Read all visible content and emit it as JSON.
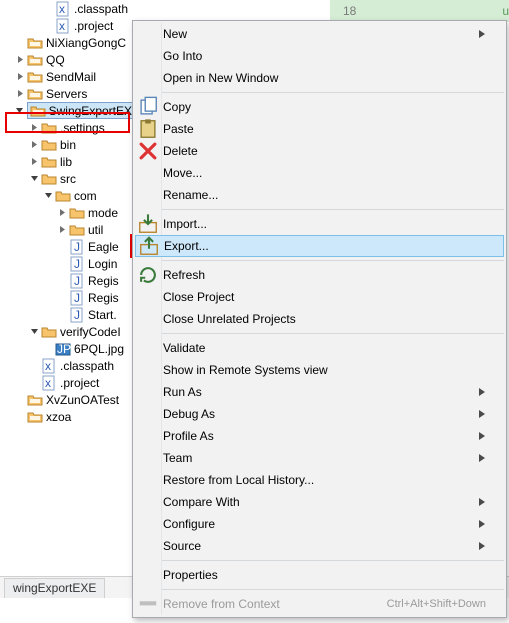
{
  "gutter": {
    "line_no": "18",
    "char": "u"
  },
  "tree": [
    {
      "indent": 3,
      "twist": "none",
      "icon": "xfile",
      "label": ".classpath"
    },
    {
      "indent": 3,
      "twist": "none",
      "icon": "xfile",
      "label": ".project"
    },
    {
      "indent": 1,
      "twist": "none",
      "icon": "project",
      "label": "NiXiangGongC"
    },
    {
      "indent": 1,
      "twist": "closed",
      "icon": "project",
      "label": "QQ"
    },
    {
      "indent": 1,
      "twist": "closed",
      "icon": "project",
      "label": "SendMail"
    },
    {
      "indent": 1,
      "twist": "closed",
      "icon": "project",
      "label": "Servers"
    },
    {
      "indent": 1,
      "twist": "open",
      "icon": "project",
      "label": "SwingExportEX",
      "selected": true
    },
    {
      "indent": 2,
      "twist": "closed",
      "icon": "folder",
      "label": ".settings"
    },
    {
      "indent": 2,
      "twist": "closed",
      "icon": "folder",
      "label": "bin"
    },
    {
      "indent": 2,
      "twist": "closed",
      "icon": "folder",
      "label": "lib"
    },
    {
      "indent": 2,
      "twist": "open",
      "icon": "folder",
      "label": "src"
    },
    {
      "indent": 3,
      "twist": "open",
      "icon": "folder",
      "label": "com"
    },
    {
      "indent": 4,
      "twist": "closed",
      "icon": "folder",
      "label": "mode"
    },
    {
      "indent": 4,
      "twist": "closed",
      "icon": "folder",
      "label": "util"
    },
    {
      "indent": 4,
      "twist": "none",
      "icon": "java",
      "label": "Eagle"
    },
    {
      "indent": 4,
      "twist": "none",
      "icon": "java",
      "label": "Login"
    },
    {
      "indent": 4,
      "twist": "none",
      "icon": "java",
      "label": "Regis"
    },
    {
      "indent": 4,
      "twist": "none",
      "icon": "java",
      "label": "Regis"
    },
    {
      "indent": 4,
      "twist": "none",
      "icon": "java",
      "label": "Start."
    },
    {
      "indent": 2,
      "twist": "open",
      "icon": "folder",
      "label": "verifyCodeI"
    },
    {
      "indent": 3,
      "twist": "none",
      "icon": "jpg",
      "label": "6PQL.jpg"
    },
    {
      "indent": 2,
      "twist": "none",
      "icon": "xfile",
      "label": ".classpath"
    },
    {
      "indent": 2,
      "twist": "none",
      "icon": "xfile",
      "label": ".project"
    },
    {
      "indent": 1,
      "twist": "none",
      "icon": "project",
      "label": "XvZunOATest"
    },
    {
      "indent": 1,
      "twist": "none",
      "icon": "project",
      "label": "xzoa"
    }
  ],
  "bottombar": {
    "tab": "wingExportEXE"
  },
  "menu": [
    {
      "type": "item",
      "icon": "",
      "label": "New",
      "sub": true
    },
    {
      "type": "item",
      "icon": "",
      "label": "Go Into"
    },
    {
      "type": "item",
      "icon": "",
      "label": "Open in New Window"
    },
    {
      "type": "sep"
    },
    {
      "type": "item",
      "icon": "copy",
      "label": "Copy"
    },
    {
      "type": "item",
      "icon": "paste",
      "label": "Paste"
    },
    {
      "type": "item",
      "icon": "delete",
      "label": "Delete"
    },
    {
      "type": "item",
      "icon": "",
      "label": "Move..."
    },
    {
      "type": "item",
      "icon": "",
      "label": "Rename..."
    },
    {
      "type": "sep"
    },
    {
      "type": "item",
      "icon": "import",
      "label": "Import..."
    },
    {
      "type": "item",
      "icon": "export",
      "label": "Export...",
      "selected": true
    },
    {
      "type": "sep"
    },
    {
      "type": "item",
      "icon": "refresh",
      "label": "Refresh"
    },
    {
      "type": "item",
      "icon": "",
      "label": "Close Project"
    },
    {
      "type": "item",
      "icon": "",
      "label": "Close Unrelated Projects"
    },
    {
      "type": "sep"
    },
    {
      "type": "item",
      "icon": "",
      "label": "Validate"
    },
    {
      "type": "item",
      "icon": "",
      "label": "Show in Remote Systems view"
    },
    {
      "type": "item",
      "icon": "",
      "label": "Run As",
      "sub": true
    },
    {
      "type": "item",
      "icon": "",
      "label": "Debug As",
      "sub": true
    },
    {
      "type": "item",
      "icon": "",
      "label": "Profile As",
      "sub": true
    },
    {
      "type": "item",
      "icon": "",
      "label": "Team",
      "sub": true
    },
    {
      "type": "item",
      "icon": "",
      "label": "Restore from Local History..."
    },
    {
      "type": "item",
      "icon": "",
      "label": "Compare With",
      "sub": true
    },
    {
      "type": "item",
      "icon": "",
      "label": "Configure",
      "sub": true
    },
    {
      "type": "item",
      "icon": "",
      "label": "Source",
      "sub": true
    },
    {
      "type": "sep"
    },
    {
      "type": "item",
      "icon": "",
      "label": "Properties"
    },
    {
      "type": "sep"
    },
    {
      "type": "item",
      "icon": "remove",
      "label": "Remove from Context",
      "accel": "Ctrl+Alt+Shift+Down",
      "disabled": true
    }
  ]
}
